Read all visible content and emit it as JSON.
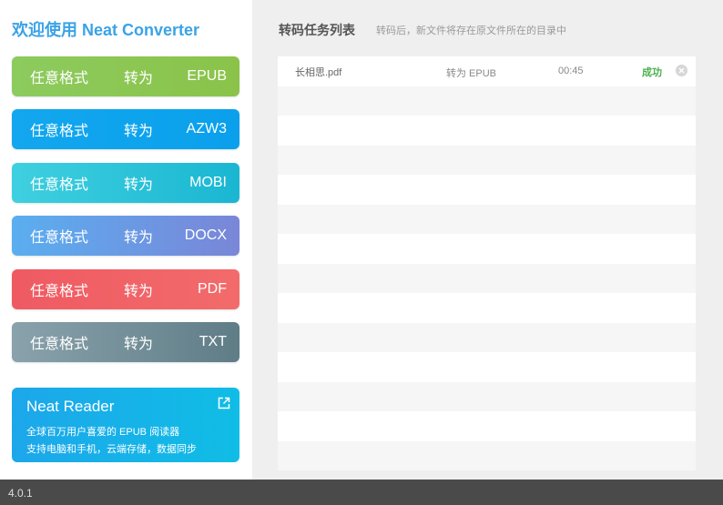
{
  "sidebar": {
    "title": "欢迎使用 Neat Converter",
    "buttons": [
      {
        "from": "任意格式",
        "to": "转为",
        "format": "EPUB"
      },
      {
        "from": "任意格式",
        "to": "转为",
        "format": "AZW3"
      },
      {
        "from": "任意格式",
        "to": "转为",
        "format": "MOBI"
      },
      {
        "from": "任意格式",
        "to": "转为",
        "format": "DOCX"
      },
      {
        "from": "任意格式",
        "to": "转为",
        "format": "PDF"
      },
      {
        "from": "任意格式",
        "to": "转为",
        "format": "TXT"
      }
    ],
    "promo": {
      "title": "Neat Reader",
      "line1": "全球百万用户喜爱的 EPUB 阅读器",
      "line2": "支持电脑和手机，云端存储，数据同步"
    }
  },
  "main": {
    "title": "转码任务列表",
    "subtitle": "转码后，新文件将存在原文件所在的目录中",
    "tasks": [
      {
        "name": "长相思.pdf",
        "target": "转为 EPUB",
        "time": "00:45",
        "status": "成功"
      }
    ]
  },
  "footer": {
    "version": "4.0.1"
  }
}
